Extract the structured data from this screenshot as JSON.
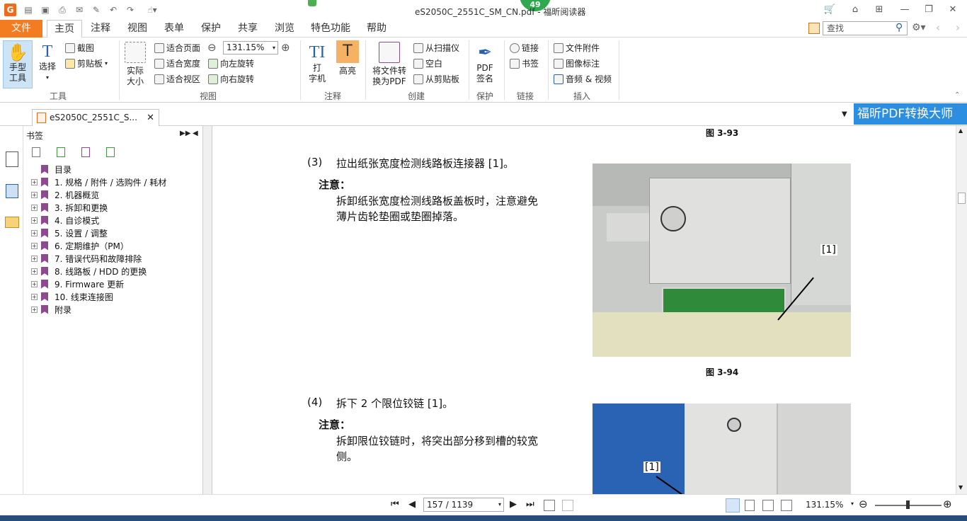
{
  "window": {
    "title": "eS2050C_2551C_SM_CN.pdf - 福昕阅读器",
    "badge": "49"
  },
  "menu": {
    "tabs": [
      "文件",
      "主页",
      "注释",
      "视图",
      "表单",
      "保护",
      "共享",
      "浏览",
      "特色功能",
      "帮助"
    ]
  },
  "search": {
    "placeholder": "查找"
  },
  "ribbon": {
    "hand": "手型\n工具",
    "select": "选择",
    "screenshot": "截图",
    "clipboard": "剪贴板",
    "actual_size": "实际\n大小",
    "fit_page": "适合页面",
    "fit_width": "适合宽度",
    "fit_view": "适合视区",
    "zoom_value": "131.15%",
    "rotate_left": "向左旋转",
    "rotate_right": "向右旋转",
    "typewriter": "打\n字机",
    "highlight": "高亮",
    "to_pdf": "将文件转\n换为PDF",
    "from_scanner": "从扫描仪",
    "blank": "空白",
    "from_clipboard": "从剪贴板",
    "pdf_sign": "PDF\n签名",
    "link": "链接",
    "bookmark": "书签",
    "file_attach": "文件附件",
    "image_mark": "图像标注",
    "audio_video": "音频 & 视频",
    "groups": {
      "tools": "工具",
      "view": "视图",
      "comment": "注释",
      "create": "创建",
      "protect": "保护",
      "link": "链接",
      "insert": "插入"
    }
  },
  "doc_tab": {
    "label": "eS2050C_2551C_S..."
  },
  "banner": {
    "text": "福昕PDF转换大师"
  },
  "bookmarks": {
    "title": "书签",
    "items": [
      "目录",
      "1. 规格 / 附件 / 选购件 / 耗材",
      "2. 机器概览",
      "3. 拆卸和更换",
      "4. 自诊模式",
      "5. 设置 / 调整",
      "6. 定期维护（PM）",
      "7. 错误代码和故障排除",
      "8. 线路板 / HDD 的更换",
      "9. Firmware 更新",
      "10. 线束连接图",
      "附录"
    ]
  },
  "page": {
    "fig93": "图 3-93",
    "step3_num": "(3)",
    "step3_text": "拉出纸张宽度检测线路板连接器 [1]。",
    "note_label": "注意：",
    "note3_line1": "拆卸纸张宽度检测线路板盖板时，注意避免",
    "note3_line2": "薄片齿轮垫圈或垫圈掉落。",
    "callout1": "[1]",
    "fig94": "图 3-94",
    "step4_num": "(4)",
    "step4_text": "拆下 2 个限位铰链 [1]。",
    "note4_line1": "拆卸限位铰链时，将突出部分移到槽的较宽",
    "note4_line2": "侧。",
    "callout2": "[1]"
  },
  "status": {
    "page_display": "157 / 1139",
    "zoom": "131.15%"
  }
}
